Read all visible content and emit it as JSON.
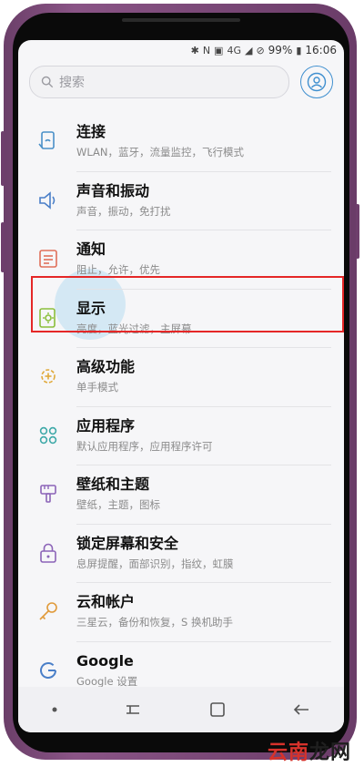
{
  "status": {
    "signal": "4G",
    "battery": "99%",
    "time": "16:06"
  },
  "search": {
    "placeholder": "搜索"
  },
  "settings": [
    {
      "title": "连接",
      "subtitle": "WLAN，蓝牙，流量监控，飞行模式",
      "icon": "link-icon",
      "color": "#4a90c8"
    },
    {
      "title": "声音和振动",
      "subtitle": "声音，振动，免打扰",
      "icon": "speaker-icon",
      "color": "#4a7fc8"
    },
    {
      "title": "通知",
      "subtitle": "阻止，允许，优先",
      "icon": "notification-icon",
      "color": "#e0705a"
    },
    {
      "title": "显示",
      "subtitle": "亮度，蓝光过滤，主屏幕",
      "icon": "display-icon",
      "color": "#8bbf3c"
    },
    {
      "title": "高级功能",
      "subtitle": "单手模式",
      "icon": "gear-plus-icon",
      "color": "#e0a93a"
    },
    {
      "title": "应用程序",
      "subtitle": "默认应用程序，应用程序许可",
      "icon": "apps-icon",
      "color": "#3ea9a8"
    },
    {
      "title": "壁纸和主题",
      "subtitle": "壁纸，主题，图标",
      "icon": "brush-icon",
      "color": "#8c64b8"
    },
    {
      "title": "锁定屏幕和安全",
      "subtitle": "息屏提醒，面部识别，指纹，虹膜",
      "icon": "lock-icon",
      "color": "#8c64b8"
    },
    {
      "title": "云和帐户",
      "subtitle": "三星云，备份和恢复，S 换机助手",
      "icon": "key-icon",
      "color": "#e09a3a"
    },
    {
      "title": "Google",
      "subtitle": "Google 设置",
      "icon": "google-icon",
      "color": "#4a7fc8"
    }
  ],
  "watermark": {
    "part1": "云南",
    "part2": "龙网"
  }
}
